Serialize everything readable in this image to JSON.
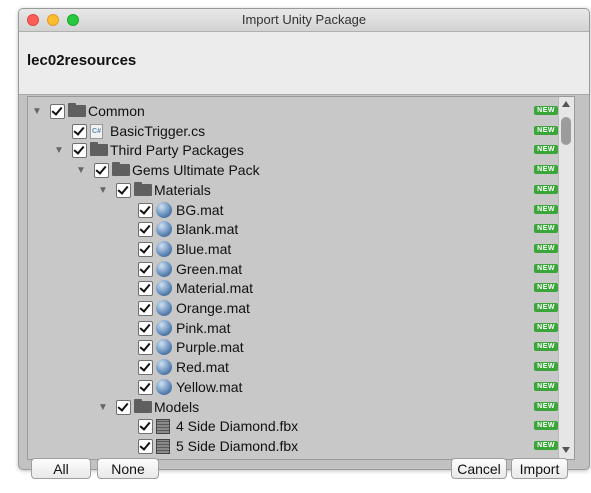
{
  "window": {
    "title": "Import Unity Package"
  },
  "header": {
    "package_name": "lec02resources"
  },
  "tree": {
    "badge_text": "NEW",
    "items": [
      {
        "label": "Common",
        "type": "folder",
        "depth": 0,
        "expanded": true
      },
      {
        "label": "BasicTrigger.cs",
        "type": "cs",
        "depth": 1
      },
      {
        "label": "Third Party Packages",
        "type": "folder",
        "depth": 1,
        "expanded": true
      },
      {
        "label": "Gems Ultimate Pack",
        "type": "folder",
        "depth": 2,
        "expanded": true
      },
      {
        "label": "Materials",
        "type": "folder",
        "depth": 3,
        "expanded": true
      },
      {
        "label": "BG.mat",
        "type": "mat",
        "depth": 4
      },
      {
        "label": "Blank.mat",
        "type": "mat",
        "depth": 4
      },
      {
        "label": "Blue.mat",
        "type": "mat",
        "depth": 4
      },
      {
        "label": "Green.mat",
        "type": "mat",
        "depth": 4
      },
      {
        "label": "Material.mat",
        "type": "mat",
        "depth": 4
      },
      {
        "label": "Orange.mat",
        "type": "mat",
        "depth": 4
      },
      {
        "label": "Pink.mat",
        "type": "mat",
        "depth": 4
      },
      {
        "label": "Purple.mat",
        "type": "mat",
        "depth": 4
      },
      {
        "label": "Red.mat",
        "type": "mat",
        "depth": 4
      },
      {
        "label": "Yellow.mat",
        "type": "mat",
        "depth": 4
      },
      {
        "label": "Models",
        "type": "folder",
        "depth": 3,
        "expanded": true
      },
      {
        "label": "4 Side Diamond.fbx",
        "type": "fbx",
        "depth": 4
      },
      {
        "label": "5 Side Diamond.fbx",
        "type": "fbx",
        "depth": 4
      }
    ]
  },
  "buttons": {
    "all": "All",
    "none": "None",
    "cancel": "Cancel",
    "import": "Import"
  }
}
